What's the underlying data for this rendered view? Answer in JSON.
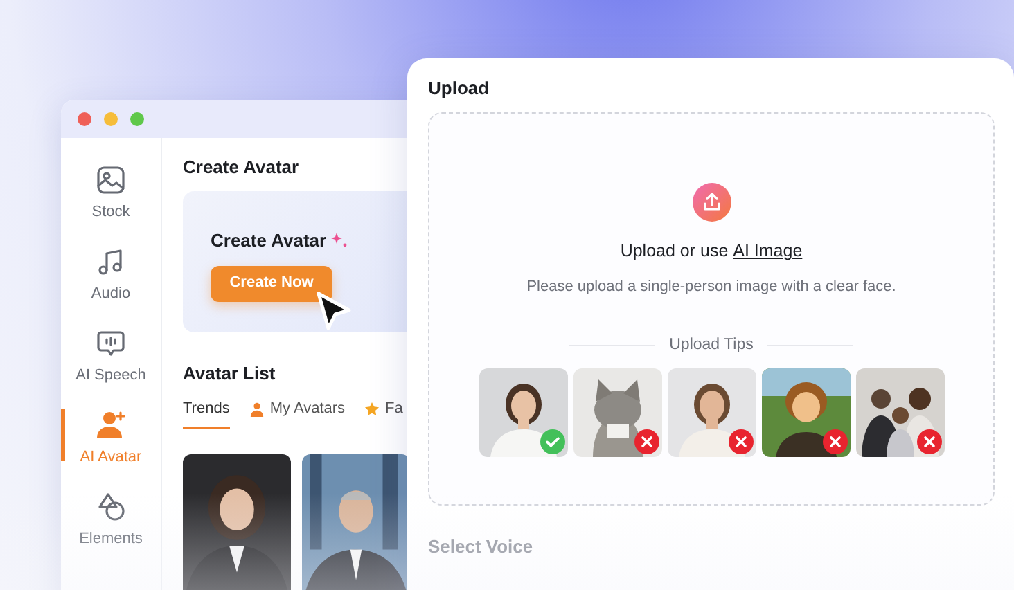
{
  "editor_window": {
    "sidebar": {
      "items": [
        {
          "label": "Stock",
          "selected": false
        },
        {
          "label": "Audio",
          "selected": false
        },
        {
          "label": "AI Speech",
          "selected": false
        },
        {
          "label": "AI Avatar",
          "selected": true
        },
        {
          "label": "Elements",
          "selected": false
        }
      ]
    },
    "create_section": {
      "title": "Create Avatar",
      "card_title": "Create Avatar",
      "button": "Create Now"
    },
    "avatar_list": {
      "title": "Avatar List",
      "tabs": [
        {
          "label": "Trends",
          "selected": true
        },
        {
          "label": "My Avatars",
          "selected": false
        },
        {
          "label": "Fa",
          "selected": false
        }
      ],
      "avatars": [
        {
          "kind": "picture"
        },
        {
          "kind": "picture"
        }
      ]
    }
  },
  "upload_panel": {
    "title": "Upload",
    "prompt": "Upload or use ",
    "link": "AI Image",
    "hint": "Please upload a single-person image with a clear face.",
    "tips_title": "Upload Tips",
    "tips": [
      {
        "kind": "picture",
        "valid": true
      },
      {
        "kind": "picture",
        "valid": false
      },
      {
        "kind": "picture",
        "valid": false
      },
      {
        "kind": "picture",
        "valid": false
      },
      {
        "kind": "picture",
        "valid": false
      }
    ],
    "next_section": "Select Voice"
  }
}
